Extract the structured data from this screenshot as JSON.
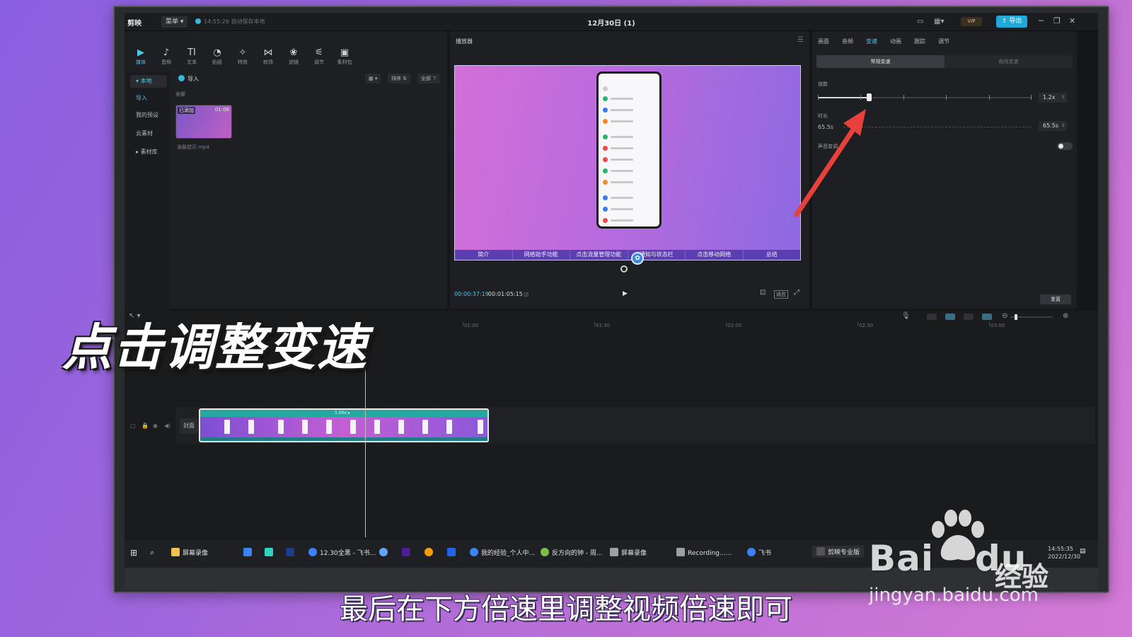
{
  "window": {
    "app_name": "剪映",
    "menu_label": "菜单",
    "autosave": "14:55:26 自动保存本地",
    "doc_title": "12月30日 (1)",
    "vip_label": "VIP",
    "export_label": "导出"
  },
  "toolbar": {
    "tabs": [
      {
        "label": "媒体",
        "icon": "media-icon"
      },
      {
        "label": "音频",
        "icon": "audio-icon"
      },
      {
        "label": "文本",
        "icon": "text-icon"
      },
      {
        "label": "贴纸",
        "icon": "sticker-icon"
      },
      {
        "label": "特效",
        "icon": "effects-icon"
      },
      {
        "label": "转场",
        "icon": "transition-icon"
      },
      {
        "label": "滤镜",
        "icon": "filter-icon"
      },
      {
        "label": "调节",
        "icon": "adjust-icon"
      },
      {
        "label": "素材包",
        "icon": "asset-pack-icon"
      }
    ]
  },
  "media": {
    "nav": [
      "本地",
      "导入",
      "我的预设",
      "云素材",
      "素材库"
    ],
    "import_label": "导入",
    "all_label": "全部",
    "sort_label": "排序",
    "filter_label": "全部",
    "thumb_tag": "已添加",
    "thumb_duration": "01:06",
    "thumb_name": "演最想示.mp4"
  },
  "player": {
    "title": "播放器",
    "subtitles": [
      "简介",
      "网络助手功能",
      "点击流量管理功能",
      "通知与状态栏",
      "点击移动网络",
      "总结"
    ],
    "current_time": "00:00:37:19",
    "total_time": "00:01:05:15",
    "ratio_label": "适应"
  },
  "inspector": {
    "tabs": [
      "画面",
      "音频",
      "变速",
      "动画",
      "跟踪",
      "调节"
    ],
    "active_tab": "变速",
    "sub_tabs": [
      "常规变速",
      "曲线变速"
    ],
    "speed_label": "倍数",
    "speed_value": "1.2x",
    "speed_fraction": 0.24,
    "duration_label": "时长",
    "duration_left": "65.5s",
    "duration_right": "65.5s",
    "pitch_label": "声音变调",
    "reset_label": "重置"
  },
  "timeline": {
    "ruler": [
      "01:00",
      "01:30",
      "02:00",
      "02:30",
      "03:00"
    ],
    "cover_label": "封面",
    "clip_speed": "1.00x ▸"
  },
  "taskbar": {
    "items": [
      {
        "label": "屏幕录像",
        "color": "#f2c14e"
      },
      {
        "label": "12.30全黑 - 飞书...",
        "color": "#3b82f6"
      },
      {
        "label": "我的经验_个人中...",
        "color": "#3b82f6"
      },
      {
        "label": "反方向的钟 - 周...",
        "color": "#7bc043"
      },
      {
        "label": "屏幕录像",
        "color": "#9aa0a6"
      },
      {
        "label": "Recording......",
        "color": "#9aa0a6"
      },
      {
        "label": "飞书",
        "color": "#3b82f6"
      },
      {
        "label": "剪映专业版",
        "color": "#555555"
      }
    ],
    "clock_time": "14:55:35",
    "clock_date": "2022/12/30"
  },
  "overlay": {
    "caption": "点击调整变速",
    "subtitle": "最后在下方倍速里调整视频倍速即可",
    "watermark_brand": "Bai",
    "watermark_du": "du",
    "watermark_cn": "经验",
    "watermark_url": "jingyan.baidu.com"
  },
  "colors": {
    "accent": "#4ec6ec",
    "arrow": "#e8413c",
    "clip": "#25a8a0"
  }
}
